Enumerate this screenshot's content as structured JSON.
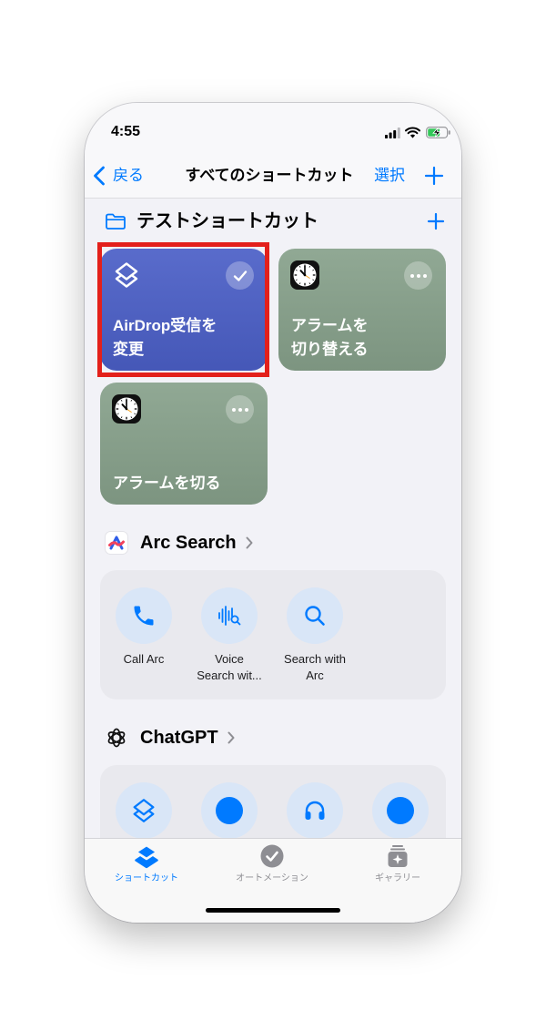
{
  "status_bar": {
    "time": "4:55",
    "battery_fill_color": "#34c759"
  },
  "nav": {
    "back_label": "戻る",
    "title": "すべてのショートカット",
    "select_label": "選択"
  },
  "folder": {
    "title": "テストショートカット",
    "icon": "folder-icon"
  },
  "tiles": [
    {
      "lines": [
        "AirDrop受信を",
        "変更"
      ],
      "icon": "shortcuts-icon",
      "action_icon": "checkmark-icon",
      "color": "#4b5fc7",
      "selected": true
    },
    {
      "lines": [
        "アラームを",
        "切り替える"
      ],
      "icon": "clock-icon",
      "action_icon": "more-icon",
      "color": "#87a18b"
    },
    {
      "lines": [
        "アラームを切る"
      ],
      "icon": "clock-icon",
      "action_icon": "more-icon",
      "color": "#87a18b"
    }
  ],
  "apps": [
    {
      "name": "Arc Search",
      "icon": "arc-search-icon",
      "actions": [
        {
          "lines": [
            "Call Arc"
          ],
          "icon": "phone-icon"
        },
        {
          "lines": [
            "Voice",
            "Search wit..."
          ],
          "icon": "voice-search-icon"
        },
        {
          "lines": [
            "Search with",
            "Arc"
          ],
          "icon": "magnifier-icon"
        }
      ]
    },
    {
      "name": "ChatGPT",
      "icon": "chatgpt-icon",
      "actions": [
        {
          "icon": "shortcuts-icon"
        },
        {
          "icon": "dot-icon"
        },
        {
          "icon": "headphones-icon"
        },
        {
          "icon": "dot-icon"
        }
      ]
    }
  ],
  "tab_bar": {
    "items": [
      {
        "label": "ショートカット",
        "icon": "shortcuts-stack-icon",
        "active": true
      },
      {
        "label": "オートメーション",
        "icon": "automation-icon",
        "active": false
      },
      {
        "label": "ギャラリー",
        "icon": "gallery-icon",
        "active": false
      }
    ]
  },
  "colors": {
    "accent": "#007aff",
    "highlight": "#e3201b",
    "background": "#f2f2f7",
    "card": "#e9e9ee",
    "action_circle": "#d9e6f7",
    "inactive_tab": "#8e8e93"
  }
}
